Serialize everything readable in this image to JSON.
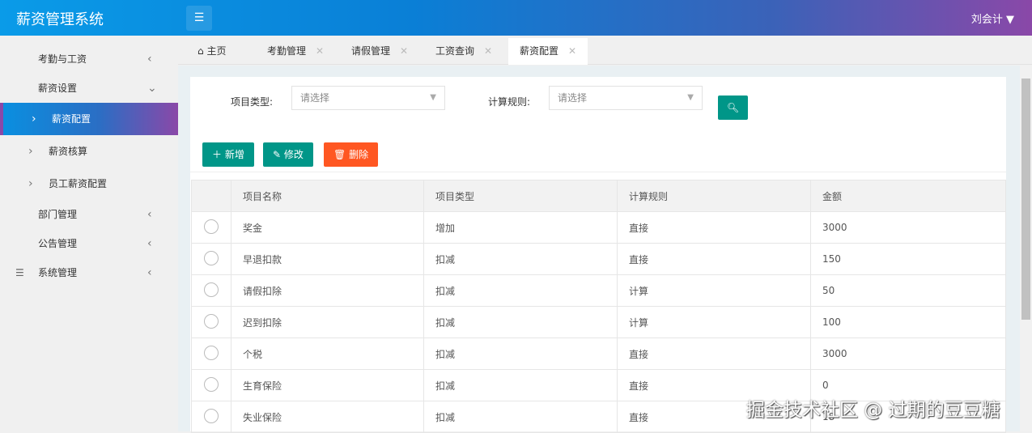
{
  "header": {
    "title": "薪资管理系统",
    "user": "刘会计"
  },
  "sidebar": {
    "items": [
      {
        "label": "考勤与工资"
      },
      {
        "label": "薪资设置"
      },
      {
        "label": "薪资配置"
      },
      {
        "label": "薪资核算"
      },
      {
        "label": "员工薪资配置"
      },
      {
        "label": "部门管理"
      },
      {
        "label": "公告管理"
      },
      {
        "label": "系统管理"
      }
    ]
  },
  "tabs": [
    {
      "label": "主页"
    },
    {
      "label": "考勤管理"
    },
    {
      "label": "请假管理"
    },
    {
      "label": "工资查询"
    },
    {
      "label": "薪资配置"
    }
  ],
  "filters": {
    "type_label": "项目类型:",
    "type_placeholder": "请选择",
    "rule_label": "计算规则:",
    "rule_placeholder": "请选择"
  },
  "toolbar": {
    "add": "新增",
    "edit": "修改",
    "delete": "删除"
  },
  "table": {
    "headers": [
      "项目名称",
      "项目类型",
      "计算规则",
      "金额"
    ],
    "rows": [
      [
        "奖金",
        "增加",
        "直接",
        "3000"
      ],
      [
        "早退扣款",
        "扣减",
        "直接",
        "150"
      ],
      [
        "请假扣除",
        "扣减",
        "计算",
        "50"
      ],
      [
        "迟到扣除",
        "扣减",
        "计算",
        "100"
      ],
      [
        "个税",
        "扣减",
        "直接",
        "3000"
      ],
      [
        "生育保险",
        "扣减",
        "直接",
        "0"
      ],
      [
        "失业保险",
        "扣减",
        "直接",
        "18"
      ]
    ]
  },
  "watermark": "掘金技术社区 @ 过期的豆豆糖"
}
